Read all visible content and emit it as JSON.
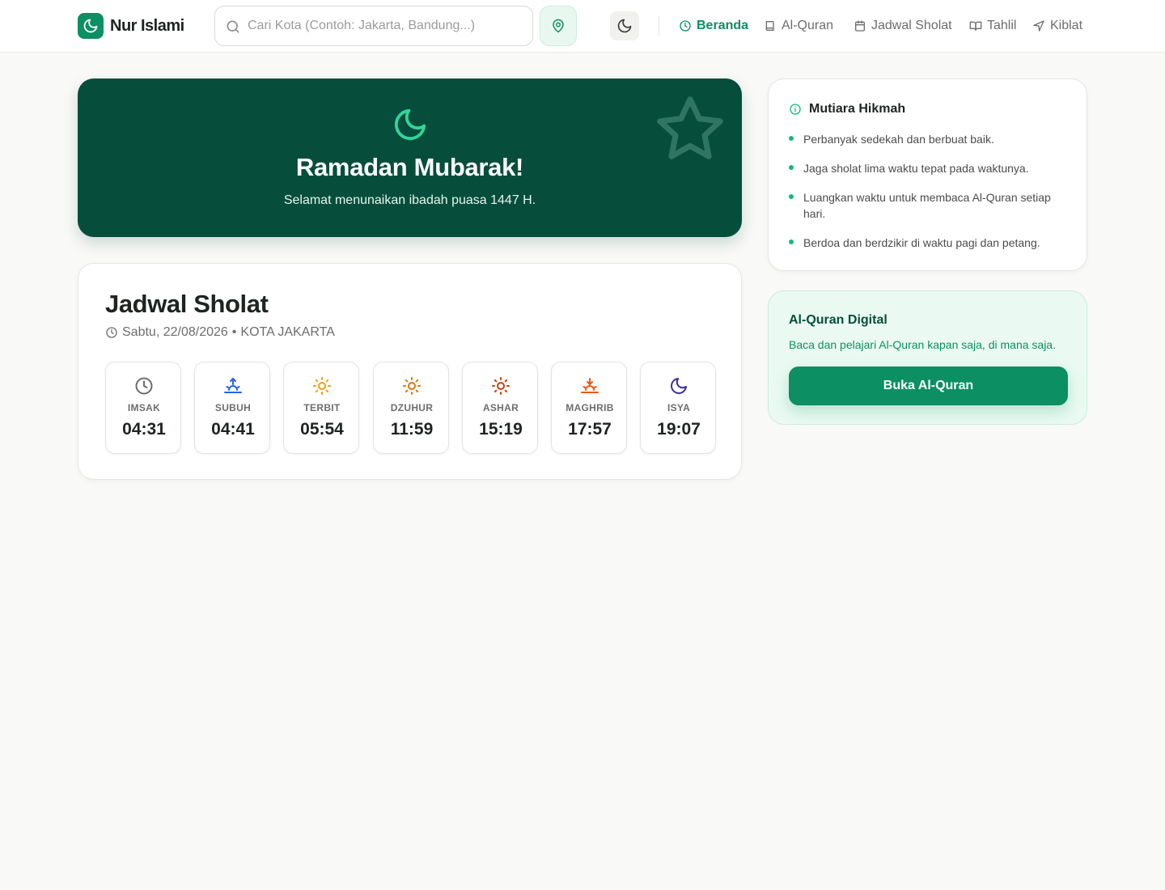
{
  "header": {
    "brand_name": "Nur Islami",
    "search_placeholder": "Cari Kota (Contoh: Jakarta, Bandung...)",
    "nav": [
      {
        "label": "Beranda",
        "icon": "clock-icon",
        "active": true
      },
      {
        "label": "Al-Quran",
        "icon": "book-icon",
        "active": false
      },
      {
        "label": "Jadwal Sholat",
        "icon": "calendar-icon",
        "active": false
      },
      {
        "label": "Tahlil",
        "icon": "open-book-icon",
        "active": false
      },
      {
        "label": "Kiblat",
        "icon": "navigation-icon",
        "active": false
      }
    ]
  },
  "hero": {
    "title": "Ramadan Mubarak!",
    "subtitle": "Selamat menunaikan ibadah puasa 1447 H."
  },
  "schedule": {
    "title": "Jadwal Sholat",
    "date": "Sabtu, 22/08/2026",
    "separator": "•",
    "city": "KOTA JAKARTA",
    "prayers": [
      {
        "name": "IMSAK",
        "time": "04:31",
        "icon": "clock-icon",
        "color": "#6b6e6b"
      },
      {
        "name": "SUBUH",
        "time": "04:41",
        "icon": "sunrise-icon",
        "color": "#2563eb"
      },
      {
        "name": "TERBIT",
        "time": "05:54",
        "icon": "sun-icon",
        "color": "#f59e0b"
      },
      {
        "name": "DZUHUR",
        "time": "11:59",
        "icon": "sun-icon",
        "color": "#d97706"
      },
      {
        "name": "ASHAR",
        "time": "15:19",
        "icon": "sun-icon",
        "color": "#c2410c"
      },
      {
        "name": "MAGHRIB",
        "time": "17:57",
        "icon": "sunset-icon",
        "color": "#ea580c"
      },
      {
        "name": "ISYA",
        "time": "19:07",
        "icon": "moon-icon",
        "color": "#3730a3"
      }
    ]
  },
  "wisdom": {
    "title": "Mutiara Hikmah",
    "items": [
      "Perbanyak sedekah dan berbuat baik.",
      "Jaga sholat lima waktu tepat pada waktunya.",
      "Luangkan waktu untuk membaca Al-Quran setiap hari.",
      "Berdoa dan berdzikir di waktu pagi dan petang."
    ]
  },
  "quran_card": {
    "title": "Al-Quran Digital",
    "description": "Baca dan pelajari Al-Quran kapan saja, di mana saja.",
    "button_label": "Buka Al-Quran"
  },
  "colors": {
    "primary": "#0b8f63",
    "hero_bg": "#064e3b",
    "accent": "#10b981",
    "page_bg": "#f9f9f7"
  }
}
